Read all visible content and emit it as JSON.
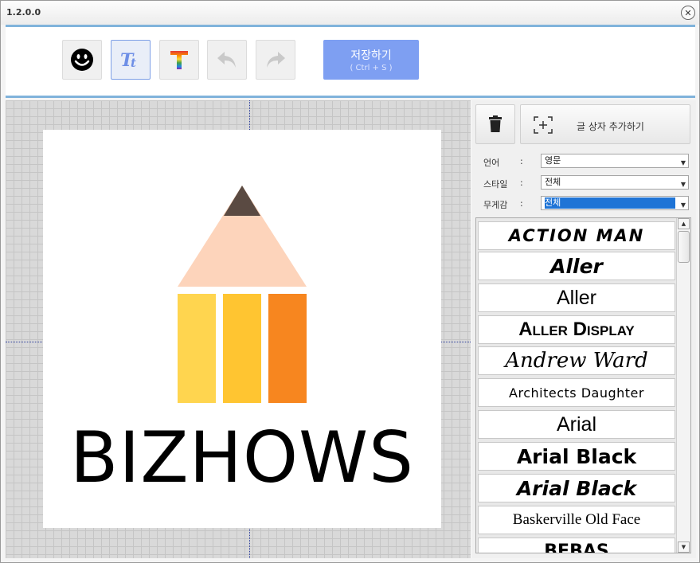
{
  "window": {
    "title": "1.2.0.0",
    "close_glyph": "✕"
  },
  "toolbar": {
    "buttons": [
      {
        "name": "emoji",
        "icon": "smiley-icon"
      },
      {
        "name": "text-style",
        "icon": "text-tt-icon",
        "active": true
      },
      {
        "name": "text-color",
        "icon": "rainbow-t-icon"
      },
      {
        "name": "undo",
        "icon": "undo-icon"
      },
      {
        "name": "redo",
        "icon": "redo-icon"
      }
    ],
    "save_label": "저장하기",
    "save_hint": "( Ctrl + S )"
  },
  "canvas": {
    "logo_text": "BIZHOWS",
    "pencil_colors": {
      "tip": "#5a4a42",
      "wood": "#fdd4bb",
      "stripe1": "#ffd54f",
      "stripe2": "#ffc531",
      "stripe3": "#f7861f"
    }
  },
  "panel": {
    "add_textbox_label": "글 상자 추가하기",
    "fields": [
      {
        "label": "언어",
        "colon": ":",
        "value": "영문"
      },
      {
        "label": "스타일",
        "colon": ":",
        "value": "전체"
      },
      {
        "label": "무게감",
        "colon": ":",
        "value": "전체"
      }
    ],
    "fonts": [
      "ACTION MAN",
      "Aller",
      "Aller",
      "Aller Display",
      "Andrew Ward",
      "Architects Daughter",
      "Arial",
      "Arial Black",
      "Arial Black",
      "Baskerville Old Face",
      "BEBAS"
    ]
  }
}
